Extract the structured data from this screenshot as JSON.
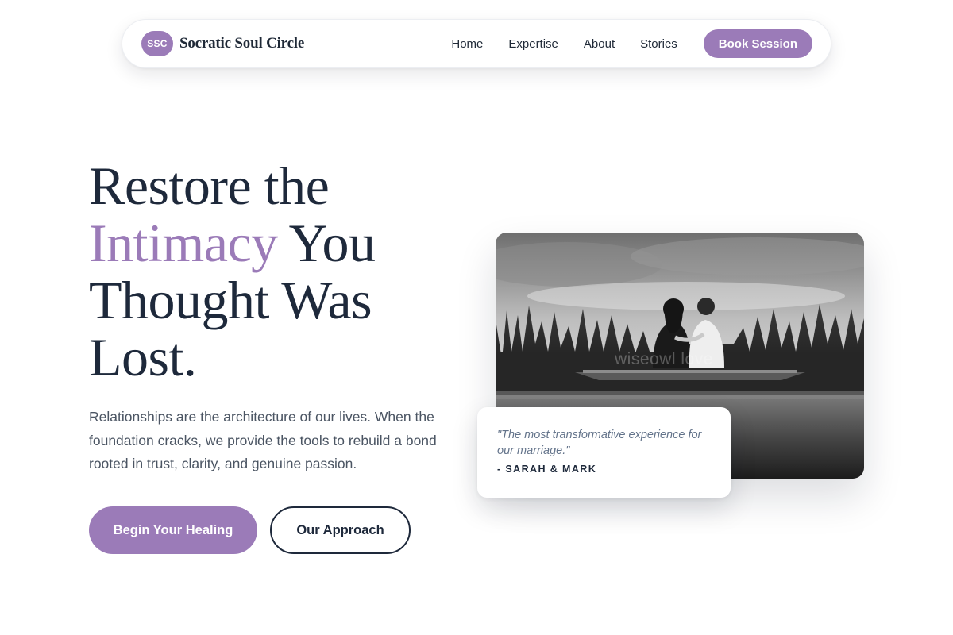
{
  "nav": {
    "logo_text": "SSC",
    "brand_name": "Socratic Soul Circle",
    "links": [
      "Home",
      "Expertise",
      "About",
      "Stories"
    ],
    "cta_label": "Book Session"
  },
  "hero": {
    "title_line1": "Restore the",
    "title_accent": "Intimacy",
    "title_after_accent": " You",
    "title_line3": "Thought Was",
    "title_line4": "Lost.",
    "subtitle": "Relationships are the architecture of our lives. When the foundation cracks, we provide the tools to rebuild a bond rooted in trust, clarity, and genuine passion.",
    "primary_button": "Begin Your Healing",
    "secondary_button": "Our Approach"
  },
  "image": {
    "alt": "Black and white photo of a couple sitting on a wooden dock among tall grass",
    "watermark": "wiseowl love"
  },
  "testimonial": {
    "quote": "\"The most transformative experience for our marriage.\"",
    "author": "- SARAH & MARK"
  },
  "colors": {
    "accent": "#9b7bb8",
    "heading": "#1e293b",
    "body": "#4b5563"
  }
}
